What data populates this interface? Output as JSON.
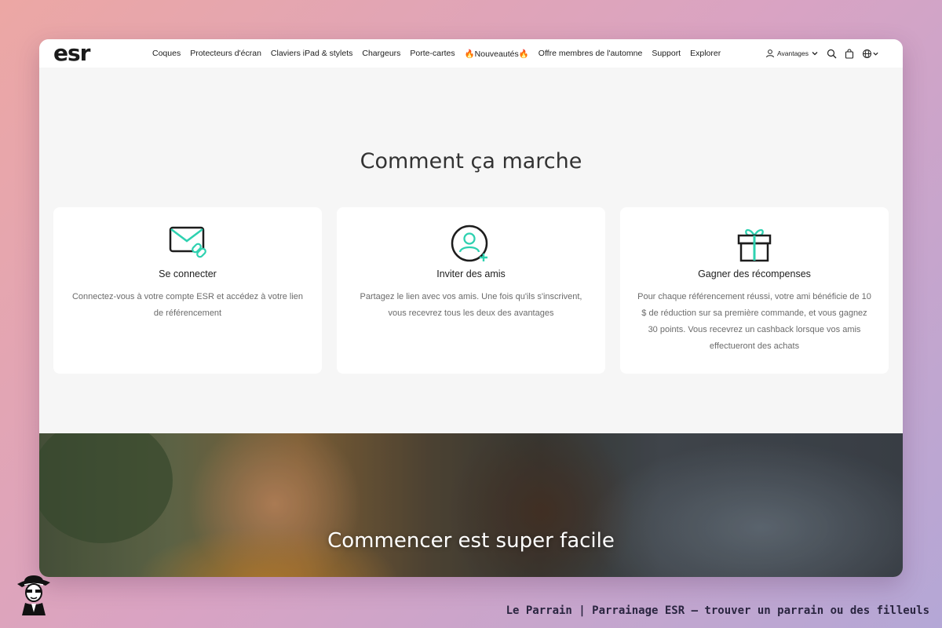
{
  "nav": {
    "logo": "esr",
    "items": [
      "Coques",
      "Protecteurs d'écran",
      "Claviers iPad & stylets",
      "Chargeurs",
      "Porte-cartes",
      "🔥Nouveautés🔥",
      "Offre membres de l'automne",
      "Support",
      "Explorer"
    ],
    "account_label": "Avantages",
    "icons": [
      "user-icon",
      "chevron-down-icon",
      "search-icon",
      "cart-icon",
      "globe-icon"
    ]
  },
  "how_it_works": {
    "title": "Comment ça marche",
    "cards": [
      {
        "icon": "envelope-link-icon",
        "title": "Se connecter",
        "description": "Connectez-vous à votre compte ESR et accédez à votre lien de référencement"
      },
      {
        "icon": "user-plus-icon",
        "title": "Inviter des amis",
        "description": "Partagez le lien avec vos amis. Une fois qu'ils s'inscrivent, vous recevrez tous les deux des avantages"
      },
      {
        "icon": "gift-icon",
        "title": "Gagner des récompenses",
        "description": "Pour chaque référencement réussi, votre ami bénéficie de 10 $ de réduction sur sa première commande, et vous gagnez 30 points. Vous recevrez un cashback lorsque vos amis effectueront des achats"
      }
    ]
  },
  "hero": {
    "title": "Commencer est super facile"
  },
  "caption": "Le Parrain | Parrainage ESR — trouver un parrain ou des filleuls",
  "colors": {
    "accent": "#2ed1b0",
    "text_dark": "#1d1d1d",
    "text_muted": "#6b6b6b",
    "page_bg": "#f6f6f6"
  }
}
